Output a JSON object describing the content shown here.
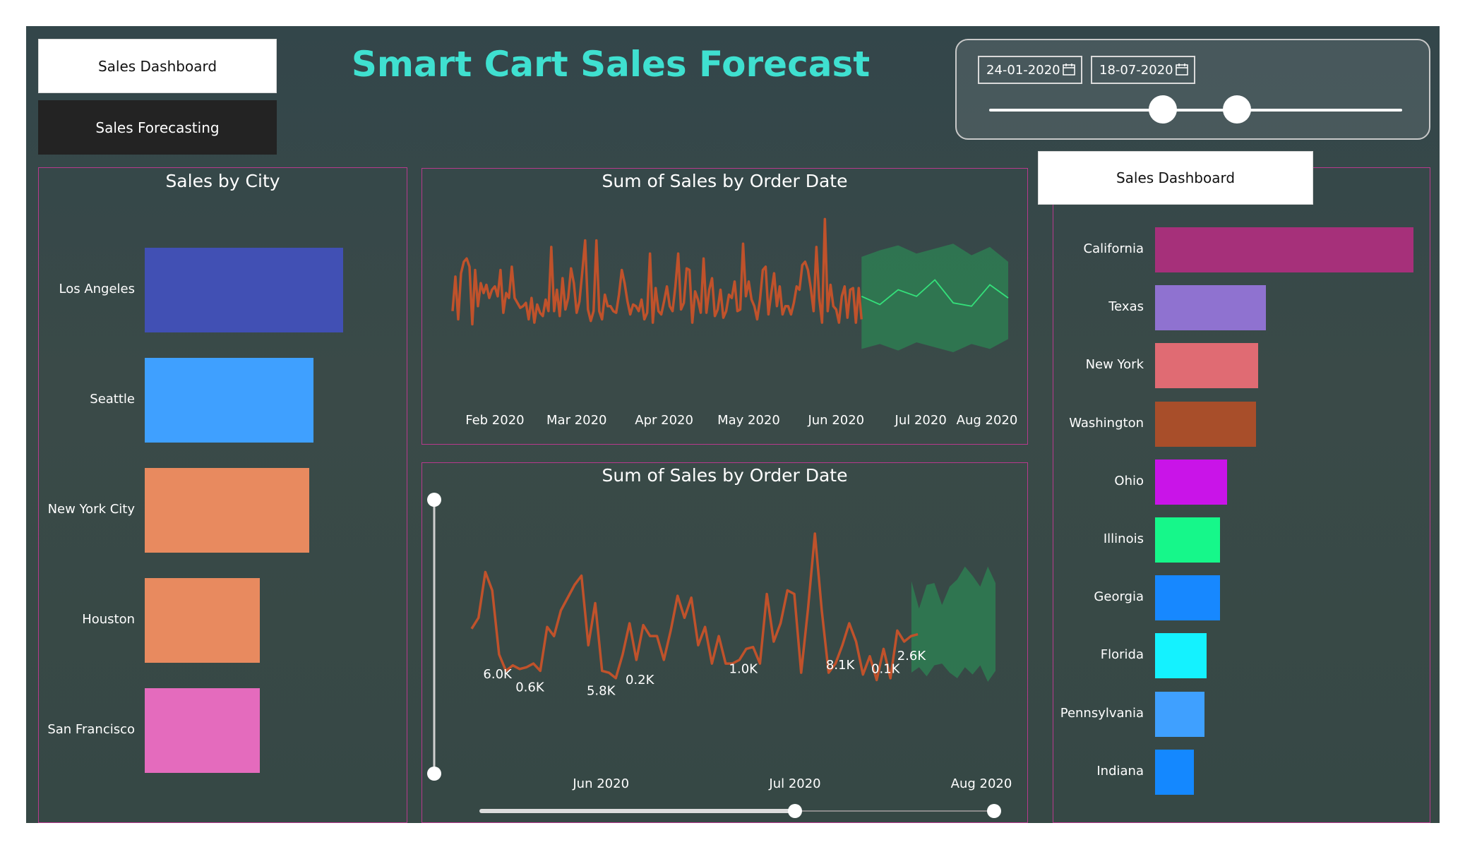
{
  "nav": {
    "sales_dashboard": "Sales Dashboard",
    "sales_forecasting": "Sales Forecasting"
  },
  "title": "Smart Cart Sales Forecast",
  "filter": {
    "start_date": "24-01-2020",
    "end_date": "18-07-2020",
    "calendar_icon": "calendar-icon",
    "range_start": 0.42,
    "range_end": 0.6
  },
  "panel_button": "Sales Dashboard",
  "colors": {
    "accent_title": "#3fe0d0",
    "line": "#c0522b",
    "forecast_band": "#2e7d52",
    "forecast_line": "#34e07a",
    "panel_border": "#b73a8d"
  },
  "chart_data": [
    {
      "type": "bar",
      "title": "Sales by City",
      "orientation": "horizontal",
      "categories": [
        "Los Angeles",
        "Seattle",
        "New York City",
        "Houston",
        "San Francisco"
      ],
      "values": [
        100,
        85,
        83,
        58,
        58
      ],
      "colors": [
        "#4150b4",
        "#3fa0ff",
        "#e88a5f",
        "#e88a5f",
        "#e46bbd"
      ]
    },
    {
      "type": "line",
      "title": "Sum of Sales by Order Date",
      "x_ticks": [
        "Feb 2020",
        "Mar 2020",
        "Apr 2020",
        "May 2020",
        "Jun 2020",
        "Jul 2020",
        "Aug 2020"
      ],
      "x_range": [
        "2020-01-17",
        "2020-08-01"
      ],
      "series": [
        {
          "values": [
            2.5,
            4.6,
            2.0,
            4.8,
            5.5,
            5.7,
            5.2,
            1.7,
            5.0,
            2.8,
            4.2,
            3.6,
            4.1,
            3.3,
            3.8,
            4.0,
            3.4,
            5.0,
            2.4,
            3.6,
            3.3,
            5.2,
            3.3,
            3.0,
            2.7,
            2.8,
            3.0,
            2.0,
            3.3,
            1.8,
            2.9,
            2.4,
            2.2,
            3.2,
            2.5,
            6.4,
            2.5,
            3.8,
            2.2,
            4.5,
            2.6,
            3.3,
            5.1,
            4.2,
            2.4,
            3.1,
            4.9,
            6.8,
            2.6,
            1.9,
            2.5,
            6.8,
            2.5,
            2.0,
            3.5,
            2.8,
            2.8,
            2.5,
            2.4,
            3.5,
            5.0,
            4.2,
            3.1,
            2.3,
            2.9,
            2.8,
            2.5,
            3.2,
            2.0,
            2.4,
            6.0,
            1.8,
            3.9,
            2.5,
            2.3,
            3.1,
            4.0,
            2.8,
            2.5,
            4.0,
            6.0,
            2.6,
            3.0,
            5.1,
            5.0,
            1.8,
            3.7,
            3.2,
            2.4,
            5.7,
            2.4,
            3.8,
            4.5,
            2.2,
            2.6,
            3.8,
            2.1,
            2.5,
            3.5,
            3.3,
            4.3,
            2.5,
            2.6,
            6.6,
            3.4,
            4.3,
            3.2,
            2.8,
            2.0,
            3.2,
            5.0,
            5.2,
            2.3,
            3.6,
            4.8,
            2.8,
            4.0,
            2.3,
            2.8,
            2.8,
            2.3,
            3.0,
            4.0,
            3.8,
            5.3,
            5.5,
            5.0,
            3.9,
            2.5,
            6.4,
            3.3,
            1.8,
            8.1,
            2.5,
            4.1,
            2.8,
            2.6,
            1.8,
            3.4,
            4.0,
            2.1,
            3.8,
            3.9,
            1.8,
            3.9,
            2.0
          ]
        },
        {
          "name": "forecast",
          "values": [
            3.4,
            2.9,
            3.8,
            3.4,
            4.4,
            3.0,
            2.8,
            4.1,
            3.3
          ]
        }
      ],
      "forecast_band": {
        "upper": [
          5.8,
          6.2,
          6.5,
          6.0,
          6.3,
          6.6,
          5.9,
          6.4,
          5.5
        ],
        "lower": [
          0.2,
          0.5,
          0.1,
          0.6,
          0.3,
          0.0,
          0.5,
          0.2,
          0.8
        ]
      }
    },
    {
      "type": "line",
      "title": "Sum of Sales by Order Date",
      "x_ticks": [
        "Jun 2020",
        "Jul 2020",
        "Aug 2020"
      ],
      "x_range": [
        "2020-05-12",
        "2020-08-01"
      ],
      "series": [
        {
          "values": [
            2.9,
            3.5,
            6.0,
            5.0,
            1.5,
            0.6,
            0.9,
            0.7,
            0.8,
            1.0,
            0.6,
            3.0,
            2.5,
            3.9,
            4.6,
            5.3,
            5.8,
            2.0,
            4.3,
            0.6,
            0.5,
            0.2,
            1.5,
            3.2,
            1.2,
            3.1,
            2.5,
            2.5,
            1.2,
            2.8,
            4.7,
            3.5,
            4.6,
            2.0,
            3.0,
            1.0,
            2.5,
            1.0,
            1.0,
            1.2,
            1.8,
            1.9,
            1.0,
            4.8,
            2.2,
            3.2,
            5.0,
            4.8,
            0.5,
            4.0,
            8.1,
            3.9,
            0.5,
            1.0,
            2.0,
            3.2,
            2.2,
            0.4,
            1.4,
            0.1,
            1.8,
            0.2,
            2.8,
            2.2,
            2.5,
            2.6
          ]
        }
      ],
      "data_labels": [
        {
          "date": "2020-05-16",
          "text": "6.0K"
        },
        {
          "date": "2020-05-21",
          "text": "0.6K"
        },
        {
          "date": "2020-06-01",
          "text": "5.8K"
        },
        {
          "date": "2020-06-07",
          "text": "0.2K"
        },
        {
          "date": "2020-06-23",
          "text": "1.0K"
        },
        {
          "date": "2020-07-08",
          "text": "8.1K"
        },
        {
          "date": "2020-07-15",
          "text": "0.1K"
        },
        {
          "date": "2020-07-19",
          "text": "2.6K"
        }
      ],
      "forecast_band": {
        "start": "2020-07-19",
        "upper": [
          5.5,
          4.0,
          5.3,
          5.4,
          4.2,
          5.2,
          5.6,
          6.3,
          5.8,
          5.2,
          6.3,
          5.4
        ],
        "lower": [
          0.5,
          0.8,
          0.3,
          0.9,
          1.0,
          0.5,
          0.2,
          0.8,
          0.4,
          0.9,
          0.0,
          0.6
        ]
      }
    },
    {
      "type": "bar",
      "orientation": "horizontal",
      "categories": [
        "California",
        "Texas",
        "New York",
        "Washington",
        "Ohio",
        "Illinois",
        "Georgia",
        "Florida",
        "Pennsylvania",
        "Indiana"
      ],
      "values": [
        100,
        43,
        40,
        39,
        28,
        25,
        25,
        20,
        19,
        15
      ],
      "colors": [
        "#a6307a",
        "#8f72d0",
        "#e06b73",
        "#a84e2a",
        "#c914e8",
        "#16f78a",
        "#1788ff",
        "#14f2ff",
        "#3fa0ff",
        "#1488ff"
      ]
    }
  ]
}
